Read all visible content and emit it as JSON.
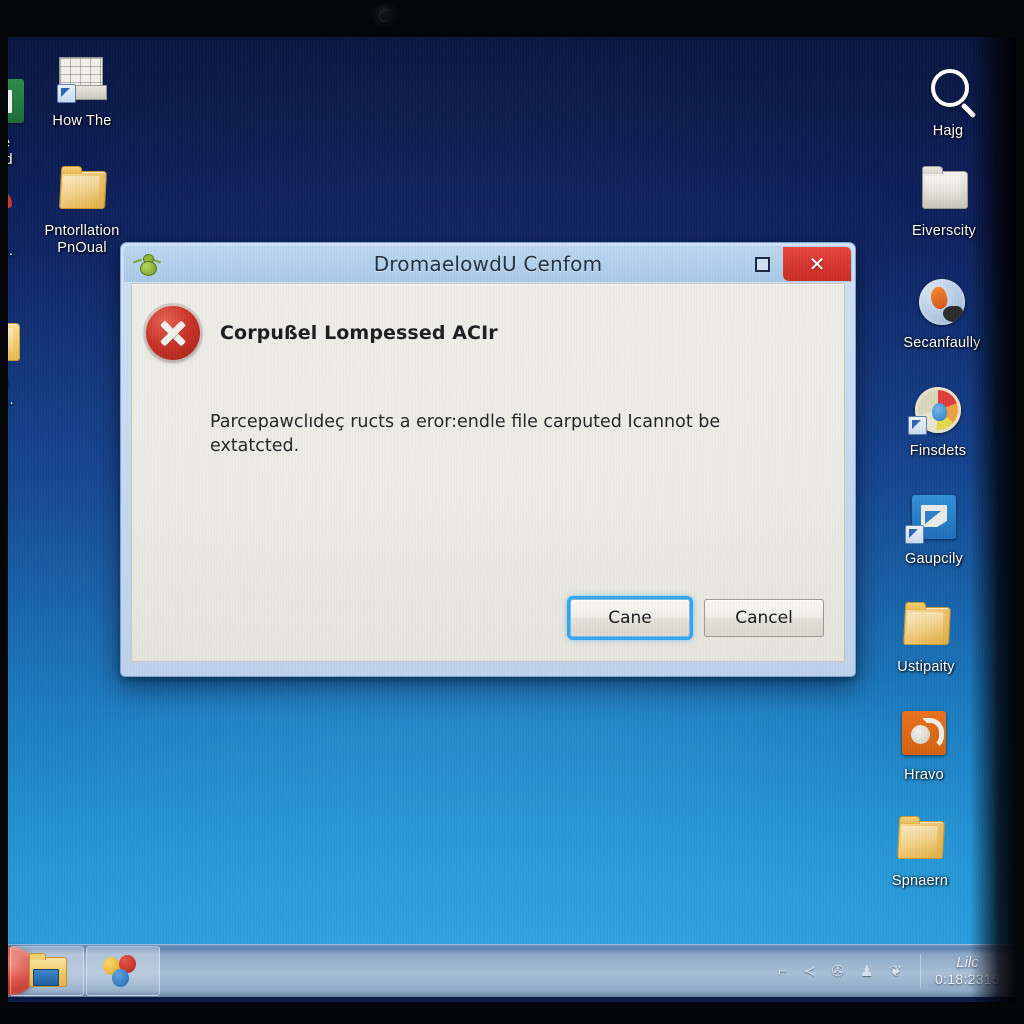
{
  "desktop": {
    "icons_left": [
      {
        "label": "he\nard",
        "icon": "green-document-icon",
        "clipped": true
      },
      {
        "label": "Sit...",
        "icon": "red-app-icon",
        "clipped": true
      },
      {
        "label": "onti\niitlo...",
        "icon": "folder-icon",
        "clipped": true
      },
      {
        "label": "How The",
        "icon": "spreadsheet-shortcut-icon",
        "clipped": false
      },
      {
        "label": "Pntorllation\nPnOual",
        "icon": "folder-icon",
        "clipped": false
      }
    ],
    "icons_right": [
      {
        "label": "Hajg",
        "icon": "search-icon"
      },
      {
        "label": "Eiverscity",
        "icon": "folder-white-icon"
      },
      {
        "label": "Secanfaully",
        "icon": "firefox-round-icon"
      },
      {
        "label": "Finsdets",
        "icon": "paint-round-shortcut-icon"
      },
      {
        "label": "Gaupcily",
        "icon": "blue-tile-shortcut-icon"
      },
      {
        "label": "Ustipaity",
        "icon": "folder-icon"
      },
      {
        "label": "Hravo",
        "icon": "orange-app-icon"
      },
      {
        "label": "Spnaern",
        "icon": "folder-icon"
      }
    ]
  },
  "dialog": {
    "title": "DromaelowdU Cenfom",
    "title_icon": "bug-icon",
    "restore_label": "",
    "close_label": "✕",
    "error_icon": "error-x-icon",
    "error_title": "Corpußel Lompessed АCIr",
    "message": "Parcepawclıdeç ructs a eror:endle file carputed Icannot be extatcted.",
    "buttons": [
      {
        "label": "Cane",
        "focused": true
      },
      {
        "label": "Cancel",
        "focused": false
      }
    ]
  },
  "taskbar": {
    "start_icon": "start-orb-icon",
    "items": [
      {
        "icon": "folder-window-icon",
        "label": ""
      },
      {
        "icon": "balloons-icon",
        "label": ""
      }
    ],
    "tray": [
      {
        "icon": "show-desktop-icon",
        "glyph": "⌐"
      },
      {
        "icon": "chevron-up-icon",
        "glyph": "≺"
      },
      {
        "icon": "network-icon",
        "glyph": "✇"
      },
      {
        "icon": "people-icon",
        "glyph": "♟"
      },
      {
        "icon": "volume-icon",
        "glyph": "❦"
      }
    ],
    "clock": {
      "time": "Lilc",
      "date": "0:18:2315"
    }
  },
  "colors": {
    "desktop_top": "#081640",
    "desktop_bottom": "#2398d8",
    "dialog_frame": "#c6d9f1",
    "close_button": "#d8352d",
    "focus_ring": "#2ea3ef",
    "error_red": "#c92f24"
  }
}
